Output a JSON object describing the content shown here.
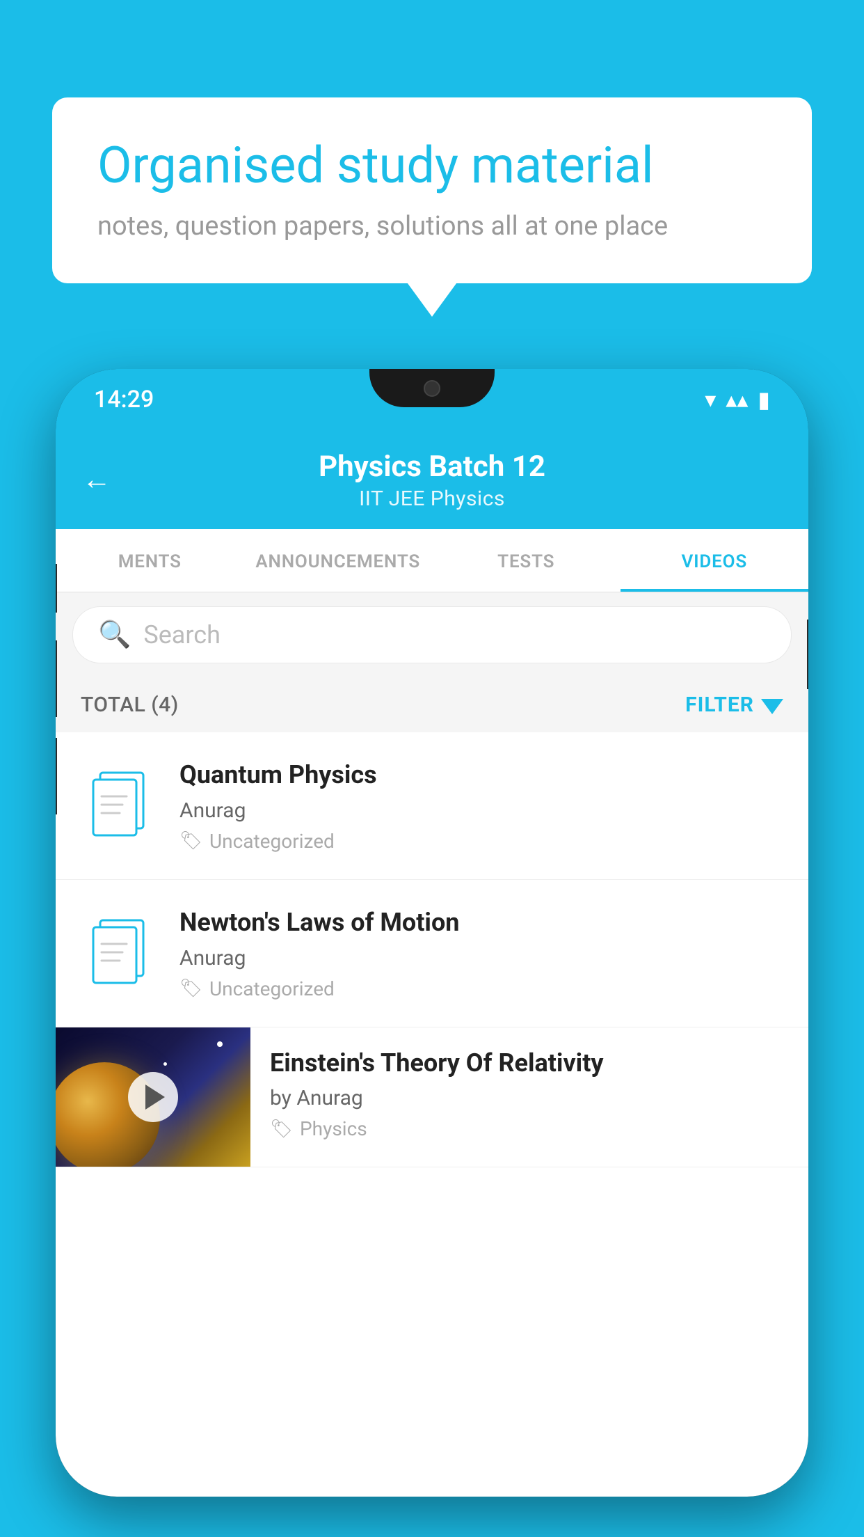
{
  "background_color": "#1bbde8",
  "speech_bubble": {
    "headline": "Organised study material",
    "subtext": "notes, question papers, solutions all at one place"
  },
  "status_bar": {
    "time": "14:29",
    "wifi": "▾",
    "signal": "▴▴",
    "battery": "▮"
  },
  "app_header": {
    "title": "Physics Batch 12",
    "subtitle": "IIT JEE   Physics",
    "back_label": "←"
  },
  "tabs": [
    {
      "label": "MENTS",
      "active": false
    },
    {
      "label": "ANNOUNCEMENTS",
      "active": false
    },
    {
      "label": "TESTS",
      "active": false
    },
    {
      "label": "VIDEOS",
      "active": true
    }
  ],
  "search": {
    "placeholder": "Search"
  },
  "filter_bar": {
    "total_label": "TOTAL (4)",
    "filter_label": "FILTER"
  },
  "videos": [
    {
      "title": "Quantum Physics",
      "author": "Anurag",
      "tag": "Uncategorized",
      "has_thumbnail": false
    },
    {
      "title": "Newton's Laws of Motion",
      "author": "Anurag",
      "tag": "Uncategorized",
      "has_thumbnail": false
    },
    {
      "title": "Einstein's Theory Of Relativity",
      "author": "by Anurag",
      "tag": "Physics",
      "has_thumbnail": true
    }
  ]
}
